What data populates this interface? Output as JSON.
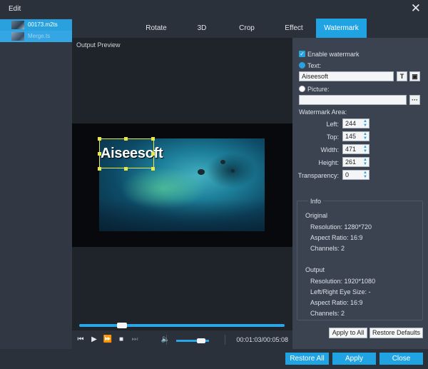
{
  "window": {
    "title": "Edit"
  },
  "files": [
    {
      "name": "00173.m2ts"
    },
    {
      "name": "Merge.ts"
    }
  ],
  "tabs": [
    {
      "label": "Rotate"
    },
    {
      "label": "3D"
    },
    {
      "label": "Crop"
    },
    {
      "label": "Effect"
    },
    {
      "label": "Watermark"
    }
  ],
  "active_tab": "Watermark",
  "preview": {
    "label": "Output Preview",
    "watermark_text": "Aiseesoft",
    "seek_progress": 0.21,
    "volume_level": 0.75,
    "time": "00:01:03/00:05:08"
  },
  "watermark": {
    "enable_label": "Enable watermark",
    "enabled": true,
    "text_label": "Text:",
    "text_value": "Aiseesoft",
    "text_selected": true,
    "picture_label": "Picture:",
    "picture_value": "",
    "picture_browse": "···",
    "text_font_btn": "T",
    "text_color_btn": "▣",
    "area_label": "Watermark Area:",
    "fields": [
      {
        "label": "Left:",
        "value": "244"
      },
      {
        "label": "Top:",
        "value": "145"
      },
      {
        "label": "Width:",
        "value": "471"
      },
      {
        "label": "Height:",
        "value": "261"
      },
      {
        "label": "Transparency:",
        "value": "0"
      }
    ]
  },
  "info": {
    "title": "Info",
    "original_label": "Original",
    "original": [
      "Resolution: 1280*720",
      "Aspect Ratio: 16:9",
      "Channels: 2"
    ],
    "output_label": "Output",
    "output": [
      "Resolution: 1920*1080",
      "Left/Right Eye Size: -",
      "Aspect Ratio: 16:9",
      "Channels: 2"
    ]
  },
  "buttons": {
    "apply_to_all": "Apply to All",
    "restore_defaults": "Restore Defaults",
    "restore_all": "Restore All",
    "apply": "Apply",
    "close": "Close"
  },
  "colors": {
    "accent": "#20a3e2",
    "watermark_box": "#e8e84a"
  }
}
